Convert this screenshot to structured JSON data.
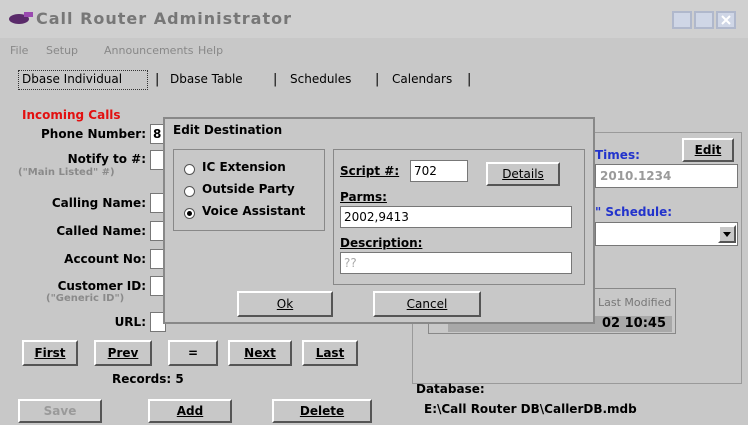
{
  "window": {
    "title": "Call Router Administrator",
    "buttons": [
      "minimize",
      "maximize",
      "close"
    ]
  },
  "menu": [
    "File",
    "Setup",
    "Announcements",
    "Help"
  ],
  "tabs": [
    {
      "label": "Dbase Individual",
      "active": true
    },
    {
      "label": "Dbase Table",
      "active": false
    },
    {
      "label": "Schedules",
      "active": false
    },
    {
      "label": "Calendars",
      "active": false
    }
  ],
  "incoming": {
    "section_label": "Incoming Calls",
    "phone_number_label": "Phone Number:",
    "phone_number_value": "8",
    "notify_label": "Notify to #:",
    "main_listed_hint": "(\"Main Listed\" #)",
    "calling_name_label": "Calling Name:",
    "called_name_label": "Called Name:",
    "account_no_label": "Account No:",
    "customer_id_label": "Customer ID:",
    "customer_id_hint": "(\"Generic ID\")",
    "url_label": "URL:"
  },
  "right_panel": {
    "times_label": "Times:",
    "edit_button": "Edit",
    "times_value": "2010.1234",
    "schedule_label": "\" Schedule:",
    "last_modified_label": "Last Modified",
    "last_modified_value": "02 10:45",
    "database_label": "Database:",
    "database_path": "E:\\Call Router DB\\CallerDB.mdb"
  },
  "navigation": {
    "first": "First",
    "prev": "Prev",
    "equals": "=",
    "next": "Next",
    "last": "Last",
    "records": "Records: 5"
  },
  "actions": {
    "save": "Save",
    "add": "Add",
    "delete": "Delete"
  },
  "dialog": {
    "title": "Edit Destination",
    "options": [
      {
        "label": "IC Extension",
        "selected": false
      },
      {
        "label": "Outside Party",
        "selected": false
      },
      {
        "label": "Voice Assistant",
        "selected": true
      }
    ],
    "script_label": "Script #:",
    "script_value": "702",
    "details_button": "Details",
    "parms_label": "Parms:",
    "parms_value": "2002,9413",
    "description_label": "Description:",
    "description_placeholder": "??",
    "ok_button": "Ok",
    "cancel_button": "Cancel"
  }
}
